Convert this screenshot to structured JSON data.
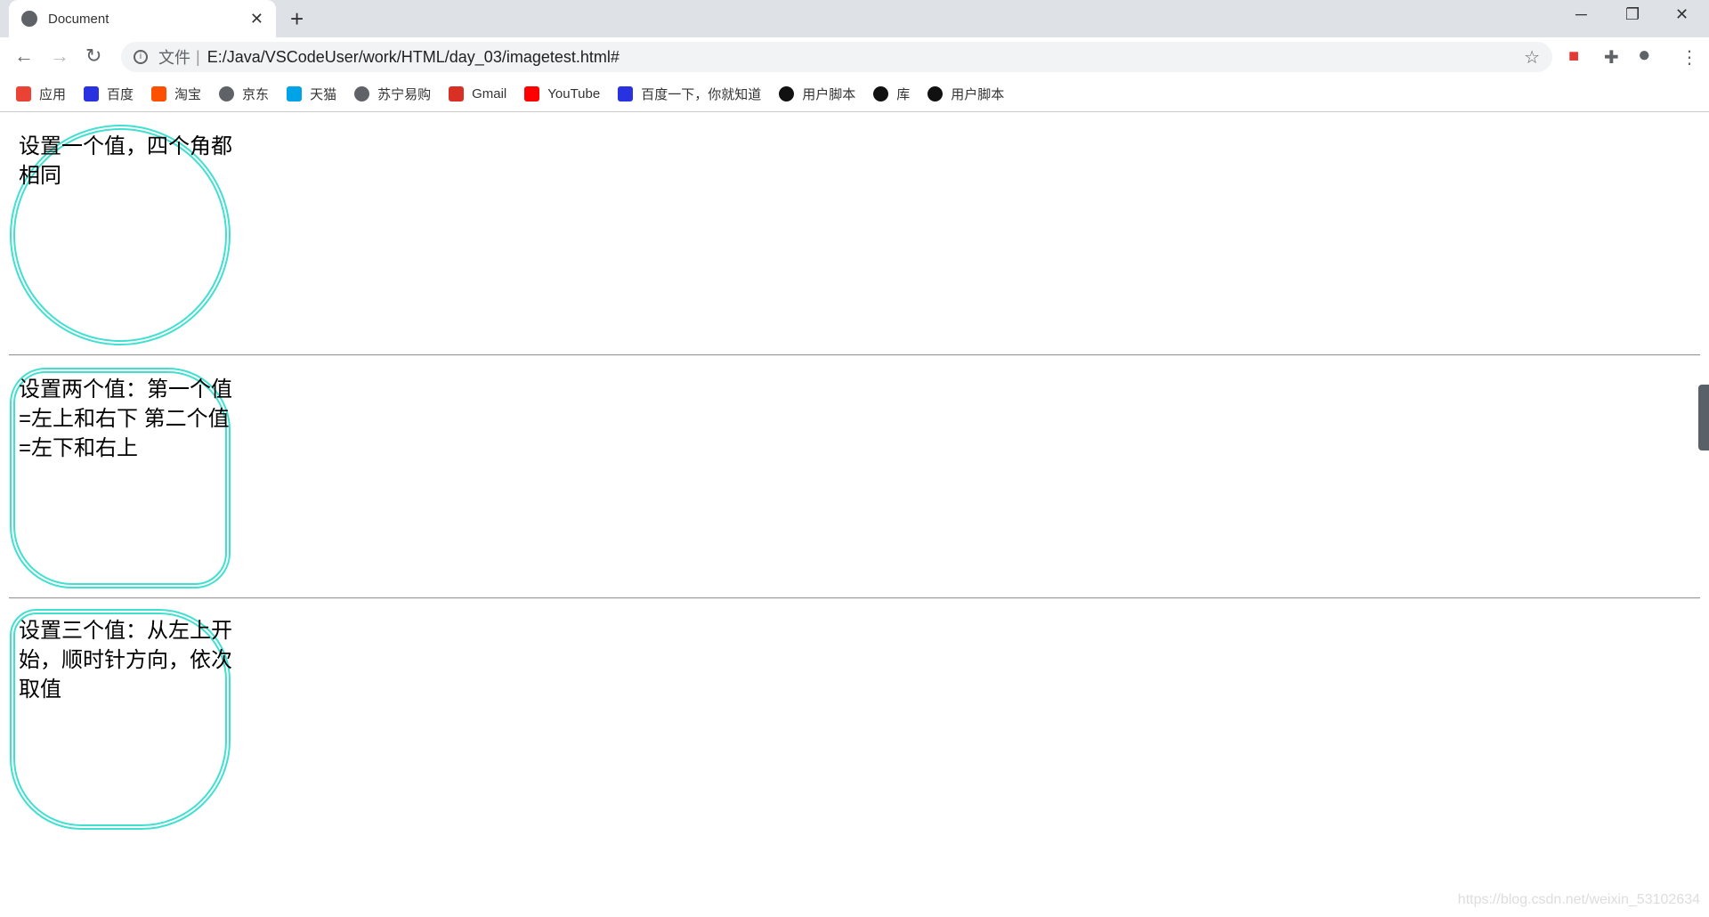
{
  "browser": {
    "tab_title": "Document",
    "url_scheme": "文件",
    "url": "E:/Java/VSCodeUser/work/HTML/day_03/imagetest.html#"
  },
  "bookmarks": [
    {
      "label": "应用",
      "icon": "apps-grid-icon",
      "color": "#ea4335"
    },
    {
      "label": "百度",
      "icon": "baidu-paw-icon",
      "color": "#2932e1"
    },
    {
      "label": "淘宝",
      "icon": "taobao-icon",
      "color": "#ff5000"
    },
    {
      "label": "京东",
      "icon": "globe-icon",
      "color": "#5f6368"
    },
    {
      "label": "天猫",
      "icon": "tmall-icon",
      "color": "#00a2e8"
    },
    {
      "label": "苏宁易购",
      "icon": "globe-icon",
      "color": "#5f6368"
    },
    {
      "label": "Gmail",
      "icon": "gmail-icon",
      "color": "#d93025"
    },
    {
      "label": "YouTube",
      "icon": "youtube-icon",
      "color": "#ff0000"
    },
    {
      "label": "百度一下，你就知道",
      "icon": "baidu-paw-icon",
      "color": "#2932e1"
    },
    {
      "label": "用户脚本",
      "icon": "userscript-icon",
      "color": "#111111"
    },
    {
      "label": "库",
      "icon": "userscript-icon",
      "color": "#111111"
    },
    {
      "label": "用户脚本",
      "icon": "userscript-icon",
      "color": "#111111"
    }
  ],
  "boxes": [
    {
      "text": "设置一个值，四个角都相同"
    },
    {
      "text": "设置两个值：第一个值=左上和右下 第二个值=左下和右上"
    },
    {
      "text": "设置三个值：从左上开始，顺时针方向，依次取值"
    }
  ],
  "border_color": "#40e0d0",
  "watermark": "https://blog.csdn.net/weixin_53102634"
}
